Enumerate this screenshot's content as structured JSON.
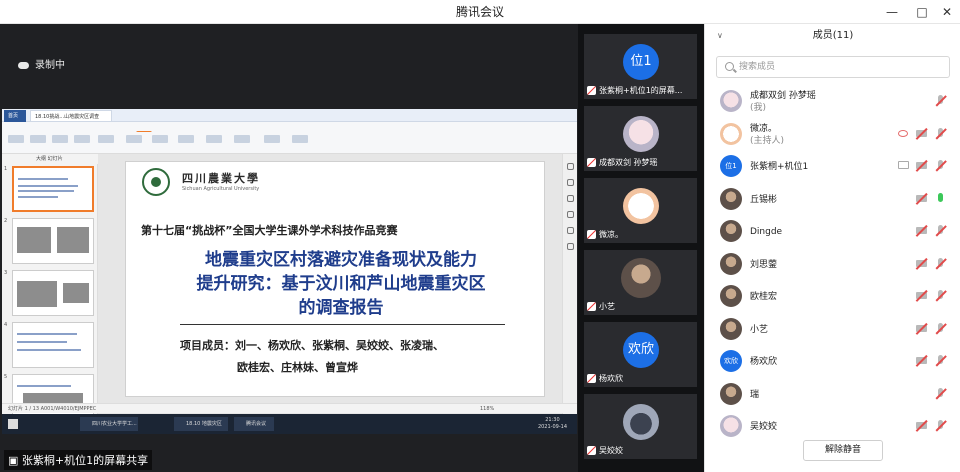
{
  "window": {
    "title": "腾讯会议",
    "controls": [
      "minimize-icon",
      "maximize-icon",
      "close-icon"
    ]
  },
  "main": {
    "recording_text": "录制中",
    "share_label": "张紫桐+机位1的屏幕共享"
  },
  "ppt": {
    "tab_home": "首页",
    "doc_tab": "18.10挑战...山地震灾区调查",
    "menu": [
      "开始",
      "插入",
      "设计",
      "切换",
      "动画",
      "放映",
      "审阅",
      "视图",
      "开发工具",
      "会员专享"
    ],
    "active_menu": "放映",
    "thumb_tabs": "大纲  幻灯片",
    "status": "幻灯片 1 / 13    A001/W4010/EJMPPEC",
    "taskbar_items": [
      "四川农业大学学工...",
      "18.10 地震灾区调...",
      "腾讯会议"
    ],
    "clock_time": "21:30",
    "clock_date": "2021-09-14",
    "zoom": "118%"
  },
  "slide": {
    "university_cn": "四川農業大學",
    "university_en": "Sichuan Agricultural University",
    "subtitle": "第十七届“挑战杯”全国大学生课外学术科技作品竞赛",
    "title_line1": "地震重灾区村落避灾准备现状及能力",
    "title_line2": "提升研究：基于汶川和芦山地震重灾区",
    "title_line3": "的调查报告",
    "members_line1": "项目成员：刘一、杨欢欣、张紫桐、吴姣姣、张凌瑞、",
    "members_line2": "欧桂宏、庄林妹、曾宣烨"
  },
  "tiles": [
    {
      "name": "张紫桐+机位1的屏幕...",
      "avatar_text": "位1",
      "avatar": "blue",
      "mic": "muted"
    },
    {
      "name": "成都双剑 孙梦瑶",
      "avatar_text": "",
      "avatar": "anime",
      "mic": "muted"
    },
    {
      "name": "微凉。",
      "avatar_text": "",
      "avatar": "cat",
      "mic": "muted"
    },
    {
      "name": "小艺",
      "avatar_text": "",
      "avatar": "photo",
      "mic": "muted"
    },
    {
      "name": "杨欢欣",
      "avatar_text": "欢欣",
      "avatar": "blue",
      "mic": "muted"
    },
    {
      "name": "吴姣姣",
      "avatar_text": "",
      "avatar": "anime2",
      "mic": "muted"
    }
  ],
  "panel": {
    "header": "成员(11)",
    "search_placeholder": "搜索成员",
    "members": [
      {
        "name": "成都双剑 孙梦瑶",
        "role": "(我)",
        "avatar": "anime",
        "mic": "muted",
        "cam": false
      },
      {
        "name": "微凉。",
        "role": "(主持人)",
        "avatar": "cat",
        "mic": "muted",
        "cam": true,
        "extra": "eye"
      },
      {
        "name": "张紫桐+机位1",
        "role": "",
        "avatar_text": "位1",
        "avatar": "blue",
        "mic": "muted",
        "cam": true,
        "extra": "screen"
      },
      {
        "name": "丘锡彬",
        "role": "",
        "avatar": "photo",
        "mic": "active",
        "cam": true
      },
      {
        "name": "Dingde",
        "role": "",
        "avatar": "photo",
        "mic": "muted",
        "cam": true
      },
      {
        "name": "刘思蓥",
        "role": "",
        "avatar": "photo",
        "mic": "muted",
        "cam": true
      },
      {
        "name": "欧桂宏",
        "role": "",
        "avatar": "photo",
        "mic": "muted",
        "cam": true
      },
      {
        "name": "小艺",
        "role": "",
        "avatar": "photo",
        "mic": "muted",
        "cam": true
      },
      {
        "name": "杨欢欣",
        "role": "",
        "avatar_text": "欢欣",
        "avatar": "blue",
        "mic": "muted",
        "cam": true
      },
      {
        "name": "瑞",
        "role": "",
        "avatar": "photo",
        "mic": "muted",
        "cam": false
      },
      {
        "name": "吴姣姣",
        "role": "",
        "avatar": "anime",
        "mic": "muted",
        "cam": true
      }
    ],
    "unmute_all": "解除静音"
  },
  "colors": {
    "accent_blue": "#1c6fe6",
    "muted_red": "#e14b4b",
    "active_green": "#3cc85a",
    "slide_title": "#1f3d8c",
    "ppt_accent": "#f07c2b"
  }
}
